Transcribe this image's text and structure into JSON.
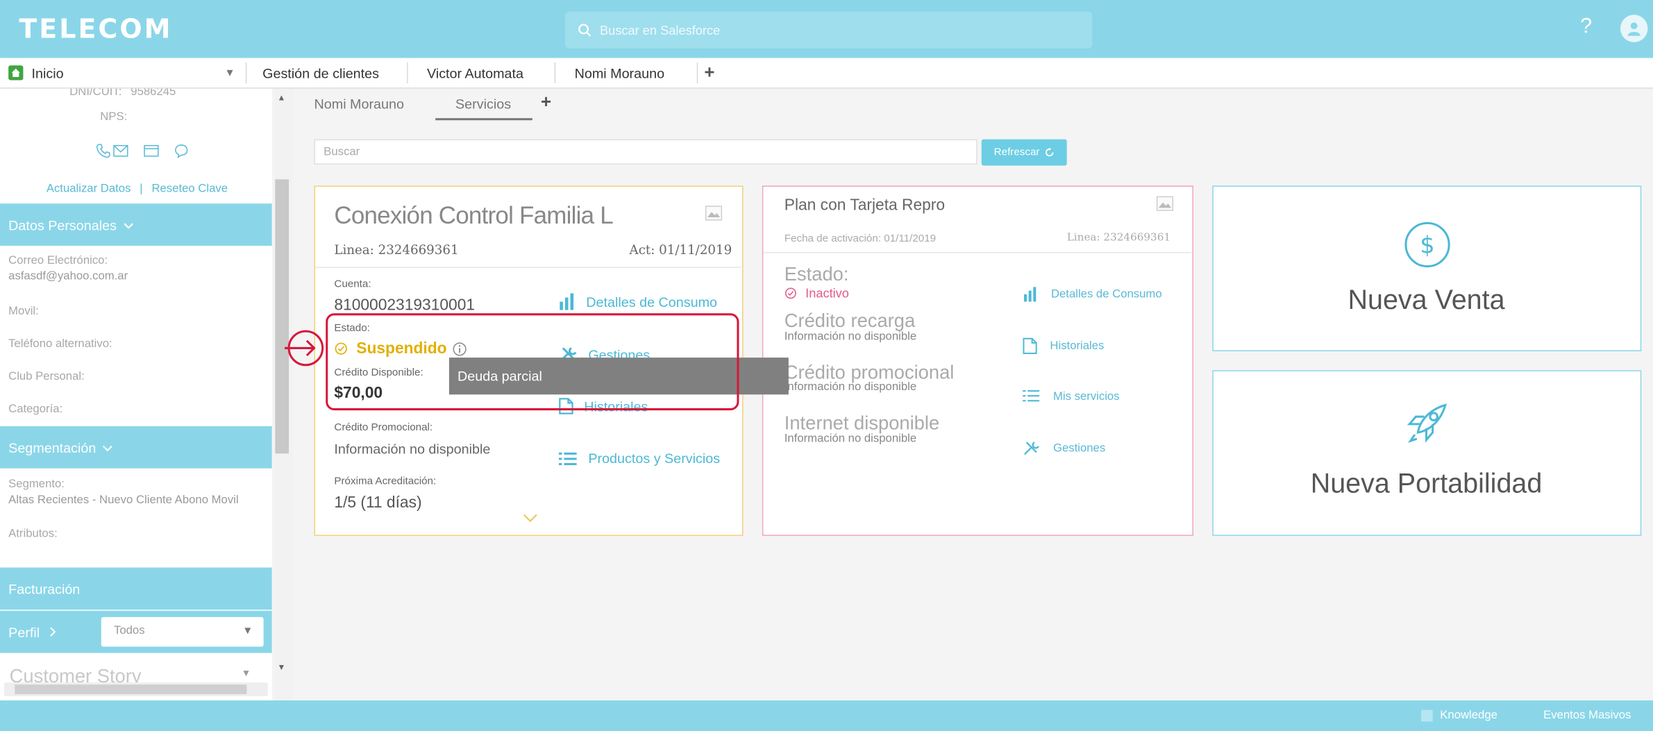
{
  "header": {
    "logo": "TELECOM",
    "search_placeholder": "Buscar en Salesforce",
    "help": "?"
  },
  "tabs": {
    "home": "Inicio",
    "items": [
      "Gestión de clientes",
      "Victor Automata",
      "Nomi Morauno"
    ],
    "add": "+"
  },
  "sidebar": {
    "dni_label": "DNI/CUIT:",
    "dni_value": "9586245",
    "nps_label": "NPS:",
    "links": {
      "update": "Actualizar Datos",
      "separator": "|",
      "reset": "Reseteo Clave"
    },
    "sections": {
      "datos_personales": "Datos Personales",
      "segmentacion": "Segmentación",
      "facturacion": "Facturación",
      "perfil": "Perfil"
    },
    "fields": {
      "email_label": "Correo Electrónico:",
      "email_value": "asfasdf@yahoo.com.ar",
      "movil_label": "Movil:",
      "tel_alt_label": "Teléfono alternativo:",
      "club_label": "Club Personal:",
      "categoria_label": "Categoría:",
      "segmento_label": "Segmento:",
      "segmento_value": "Altas Recientes - Nuevo Cliente Abono Movil",
      "atributos_label": "Atributos:"
    },
    "perfil_select": "Todos",
    "customer_story": "Customer Story"
  },
  "subtabs": {
    "items": [
      "Nomi Morauno",
      "Servicios"
    ],
    "add": "+"
  },
  "search": {
    "placeholder": "Buscar",
    "refresh": "Refrescar"
  },
  "card1": {
    "title": "Conexión Control Familia L",
    "linea": "Linea: 2324669361",
    "act": "Act: 01/11/2019",
    "cuenta_label": "Cuenta:",
    "cuenta_value": "8100002319310001",
    "estado_label": "Estado:",
    "estado_value": "Suspendido",
    "credito_label": "Crédito Disponible:",
    "credito_value": "$70,00",
    "promo_label": "Crédito Promocional:",
    "promo_value": "Información no disponible",
    "proxima_label": "Próxima Acreditación:",
    "proxima_value": "1/5 (11 días)",
    "actions": [
      "Detalles de Consumo",
      "Gestiones",
      "Historiales",
      "Productos y Servicios"
    ],
    "tooltip": "Deuda parcial"
  },
  "card2": {
    "title": "Plan con Tarjeta Repro",
    "fecha": "Fecha de activación: 01/11/2019",
    "linea": "Linea: 2324669361",
    "estado_label": "Estado:",
    "estado_value": "Inactivo",
    "recarga_label": "Crédito recarga",
    "recarga_value": "Información no disponible",
    "promo_label": "Crédito promocional",
    "promo_value": "Información no disponible",
    "internet_label": "Internet disponible",
    "internet_value": "Información no disponible",
    "actions": [
      "Detalles de Consumo",
      "Historiales",
      "Mis servicios",
      "Gestiones"
    ]
  },
  "cta": {
    "venta": "Nueva Venta",
    "portabilidad": "Nueva Portabilidad"
  },
  "footer": {
    "knowledge": "Knowledge",
    "eventos": "Eventos Masivos"
  },
  "colors": {
    "header": "#8ad6e8",
    "accent": "#4cb8d6",
    "suspended": "#e1b000",
    "inactive": "#e55a87",
    "highlight": "#d6183b"
  }
}
